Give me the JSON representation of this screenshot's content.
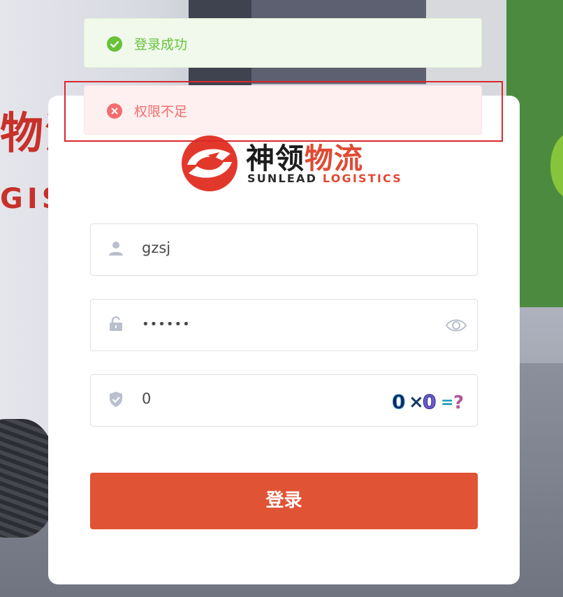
{
  "logo": {
    "cn_dark": "神领",
    "cn_red": "物流",
    "en_dark": "SUNLEAD",
    "en_red": "LOGISTICS"
  },
  "background": {
    "truck_text": "物流",
    "truck_text2": "GIST"
  },
  "form": {
    "username": {
      "value": "gzsj",
      "icon": "user-icon"
    },
    "password": {
      "value": "••••••",
      "icon": "lock-icon",
      "toggle_icon": "eye-icon"
    },
    "captcha": {
      "value": "0",
      "icon": "shield-check-icon",
      "image_text": "0×0=?"
    },
    "submit_label": "登录"
  },
  "messages": {
    "success": {
      "text": "登录成功",
      "icon": "check-circle-icon"
    },
    "error": {
      "text": "权限不足",
      "icon": "close-circle-icon"
    }
  },
  "colors": {
    "primary_button": "#e05334",
    "success": "#67c23a",
    "error": "#f56c6c",
    "highlight_border": "#d9272e"
  }
}
